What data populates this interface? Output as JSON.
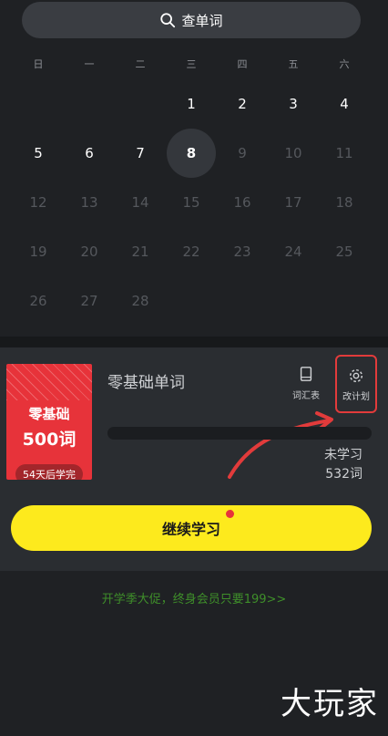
{
  "search": {
    "label": "查单词"
  },
  "weekdays": [
    "日",
    "一",
    "二",
    "三",
    "四",
    "五",
    "六"
  ],
  "calendar": [
    [
      "",
      "",
      "",
      "1",
      "2",
      "3",
      "4"
    ],
    [
      "5",
      "6",
      "7",
      "8",
      "9",
      "10",
      "11"
    ],
    [
      "12",
      "13",
      "14",
      "15",
      "16",
      "17",
      "18"
    ],
    [
      "19",
      "20",
      "21",
      "22",
      "23",
      "24",
      "25"
    ],
    [
      "26",
      "27",
      "28",
      "",
      "",
      "",
      ""
    ]
  ],
  "today": "8",
  "course": {
    "book_line1": "零基础",
    "book_line2": "500词",
    "book_badge": "54天后学完",
    "title": "零基础单词",
    "vocab_label": "词汇表",
    "plan_label": "改计划",
    "progress_fraction": 0.0,
    "unlearned_label": "未学习",
    "unlearned_count": "532词"
  },
  "continue_label": "继续学习",
  "promo": "开学季大促，终身会员只要199>>",
  "watermark": "大玩家",
  "colors": {
    "accent_red": "#e7333a",
    "button_yellow": "#fdea1d",
    "promo_green": "#3f8f2a"
  }
}
